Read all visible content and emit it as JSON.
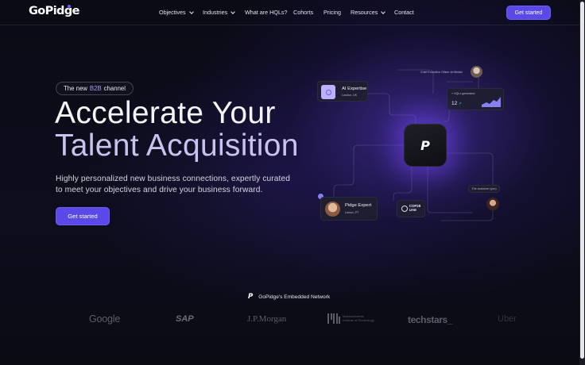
{
  "nav": {
    "logo": "GoPidge",
    "items": [
      {
        "label": "Objectives",
        "dropdown": true
      },
      {
        "label": "Industries",
        "dropdown": true
      },
      {
        "label": "What are HQLs?",
        "dropdown": false
      },
      {
        "label": "Cohorts",
        "dropdown": false
      },
      {
        "label": "Pricing",
        "dropdown": false
      },
      {
        "label": "Resources",
        "dropdown": true
      },
      {
        "label": "Contact",
        "dropdown": false
      }
    ],
    "cta": "Get started"
  },
  "hero": {
    "badge_prefix": "The new",
    "badge_accent": "B2B",
    "badge_suffix": "channel",
    "title_line1": "Accelerate Your",
    "title_line2": "Talent Acquisition",
    "subtitle": "Highly personalized new business connections, expertly curated to meet your objectives and drive your business forward.",
    "cta": "Get started"
  },
  "illustration": {
    "ai_card_title": "AI Expertise",
    "ai_card_sub": "London, UK",
    "chief_label": "Chief Executive Officer at Mintain",
    "hql_label": "HQLs generated",
    "hql_value": "12",
    "expert_title": "Pidge Expert",
    "expert_sub": "Lisbon, PT",
    "cop_line1": "COP28",
    "cop_line2": "UAE",
    "customer_label": "The customer (you)",
    "center_mark": "P"
  },
  "partners": {
    "heading": "GoPidge's Embedded Network",
    "logos": [
      "Google",
      "SAP",
      "J.P.Morgan",
      "Massachusetts Institute of Technology",
      "techstars_",
      "Uber"
    ]
  },
  "colors": {
    "accent": "#5a49e8",
    "title_secondary": "#c9c2ee",
    "background": "#0b0b16"
  }
}
